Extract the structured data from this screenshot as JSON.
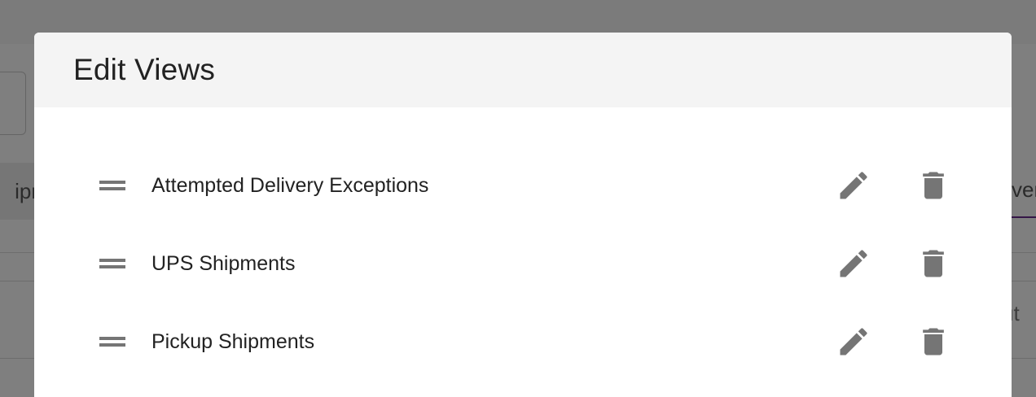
{
  "background": {
    "tab_left_text": "ipm",
    "tab_right_text": "ver",
    "right_text": "ut"
  },
  "modal": {
    "title": "Edit Views",
    "views": [
      {
        "label": "Attempted Delivery Exceptions"
      },
      {
        "label": "UPS Shipments"
      },
      {
        "label": "Pickup Shipments"
      }
    ]
  },
  "colors": {
    "icon": "#757575",
    "header_bg": "#f4f4f4",
    "text": "#222222",
    "accent": "#6a2c8e"
  },
  "icons": {
    "drag": "drag-handle-icon",
    "edit": "pencil-icon",
    "delete": "trash-icon"
  }
}
